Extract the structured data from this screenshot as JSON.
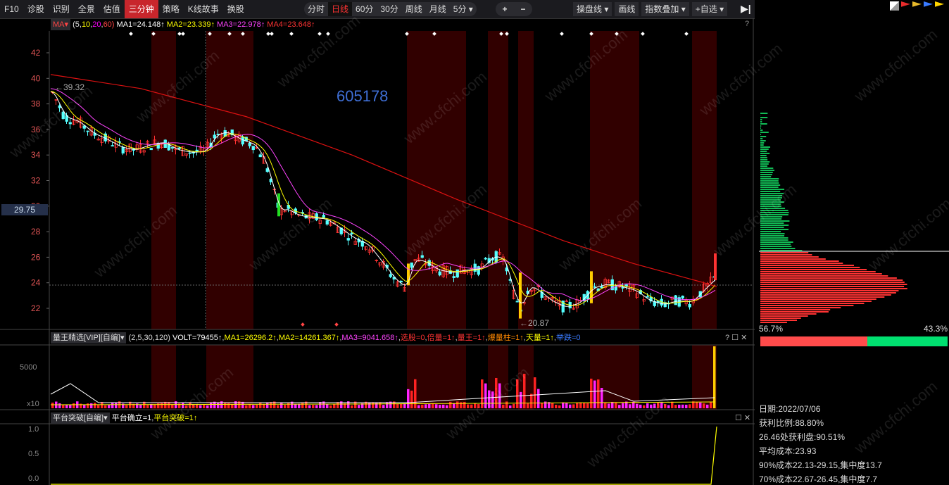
{
  "top_nav": {
    "items": [
      "F10",
      "诊股",
      "识别",
      "全景",
      "估值",
      "三分钟",
      "策略",
      "K线故事",
      "换股"
    ],
    "active": "三分钟"
  },
  "periods": {
    "items": [
      "分时",
      "日线",
      "60分",
      "30分",
      "周线",
      "月线",
      "5分 ▾"
    ],
    "active": "日线"
  },
  "zoom": {
    "plus": "+",
    "minus": "−"
  },
  "right_buttons": [
    "操盘线 ▾",
    "画线",
    "指数叠加 ▾",
    "+自选 ▾"
  ],
  "ma_bar": {
    "tag": "MA▾",
    "params_prefix": "(5,",
    "p1": "10",
    "p2": "20",
    "p3": "60)",
    "ma1": "MA1=24.148↑",
    "ma2": "MA2=23.339↑",
    "ma3": "MA3=22.978↑",
    "ma4": "MA4=23.648↑",
    "help": "?"
  },
  "stock_code": "605178",
  "price_axis": [
    "42",
    "40",
    "38",
    "36",
    "34",
    "32",
    "30",
    "28",
    "26",
    "24",
    "22"
  ],
  "current_price_label": "29.75",
  "high_label": "39.32",
  "low_label": "20.87",
  "volume_bar": {
    "tag": "量王精选[VIP][自编]▾",
    "params": "(2,5,30,120)",
    "volt": "VOLT=79455↑",
    "ma1": "MA1=26296.2↑",
    "ma2": "MA2=14261.367↑",
    "ma3": "MA3=9041.658↑",
    "j1": "选股=0",
    "j2": "倍量=1↑",
    "j3": "量王=1↑",
    "j4": "爆量柱=1↑",
    "j5": "天量=1↑",
    "j6": "举跌=0",
    "axis": [
      "5000",
      "x10"
    ]
  },
  "platform_bar": {
    "tag": "平台突破[自编]▾",
    "v1": "平台确立=1",
    "v2": "平台突破=1↑",
    "axis": [
      "1.0",
      "0.5",
      "0.0"
    ]
  },
  "profile": {
    "left_pct": "56.7%",
    "right_pct": "43.3%"
  },
  "info": [
    "日期:2022/07/06",
    "获利比例:88.80%",
    "26.46处获利盘:90.51%",
    "平均成本:23.93",
    "90%成本22.13-29.15,集中度13.7",
    "70%成本22.67-26.45,集中度7.7"
  ],
  "watermark": "www.cfchi.com",
  "colors": {
    "up": "#ff3232",
    "down": "#54ffff",
    "ma1": "#ffffff",
    "ma2": "#ffff00",
    "ma3": "#ff00ff",
    "ma4": "#ff0000",
    "bg": "#000000",
    "highlight": "#5a0000"
  }
}
